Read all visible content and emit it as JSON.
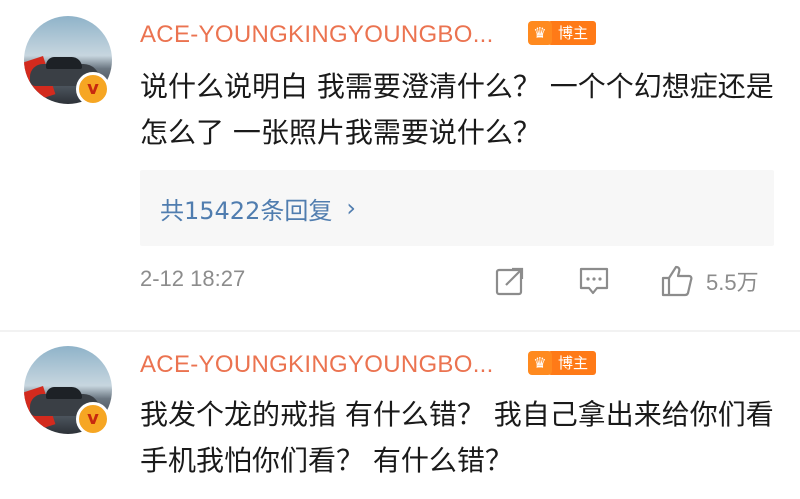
{
  "comments": [
    {
      "username": "ACE-YOUNGKINGYOUNGBO...",
      "badge": "博主",
      "verified_glyph": "v",
      "text": "说什么说明白 我需要澄清什么？ 一个个幻想症还是怎么了 一张照片我需要说什么？",
      "replies_label": "共15422条回复",
      "replies_arrow": "›",
      "timestamp": "2-12 18:27",
      "likes": "5.5万"
    },
    {
      "username": "ACE-YOUNGKINGYOUNGBO...",
      "badge": "博主",
      "verified_glyph": "v",
      "text": "我发个龙的戒指 有什么错？ 我自己拿出来给你们看手机我怕你们看？ 有什么错？"
    }
  ],
  "colors": {
    "username": "#eb7350",
    "badge_bg": "#ff7a17",
    "link": "#507daf",
    "meta": "#8c8c8c"
  },
  "icons": [
    "share-icon",
    "comment-icon",
    "like-icon",
    "verified-icon",
    "crown-icon",
    "chevron-right-icon"
  ]
}
